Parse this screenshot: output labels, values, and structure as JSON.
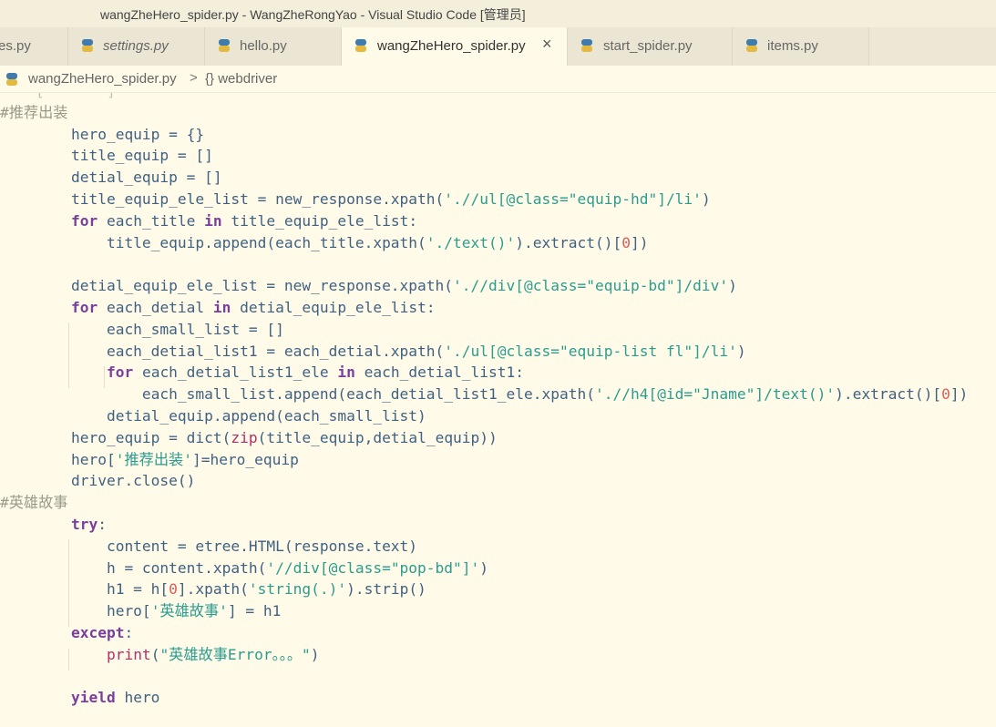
{
  "window": {
    "title": "wangZheHero_spider.py - WangZheRongYao - Visual Studio Code [管理员]"
  },
  "tabs": [
    {
      "label": "es.py",
      "italic": false,
      "active": false
    },
    {
      "label": "settings.py",
      "italic": true,
      "active": false
    },
    {
      "label": "hello.py",
      "italic": false,
      "active": false
    },
    {
      "label": "wangZheHero_spider.py",
      "italic": false,
      "active": true,
      "close": "×"
    },
    {
      "label": "start_spider.py",
      "italic": false,
      "active": false
    },
    {
      "label": "items.py",
      "italic": false,
      "active": false
    }
  ],
  "breadcrumb": {
    "file": "wangZheHero_spider.py",
    "separator": ">",
    "scope_icon": "{}",
    "scope": "webdriver"
  },
  "icons": {
    "python": "python-file-icon",
    "close": "close-icon",
    "chevron": "chevron-right-icon",
    "braces": "braces-icon"
  },
  "colors": {
    "background": "#fffbe8",
    "keyword": "#7a3e9d",
    "string": "#2a9d8f",
    "number": "#e05a5a",
    "comment": "#9a9a8a",
    "identifier": "#3f6183",
    "builtin": "#b0306a"
  },
  "code": {
    "lines": [
      [
        [
          "    [ ‘  ’  ] ‘  ’",
          "faded"
        ]
      ],
      [
        [
          "#推荐出装",
          "cm"
        ]
      ],
      [
        [
          "        hero_equip = {}",
          ""
        ]
      ],
      [
        [
          "        title_equip = []",
          ""
        ]
      ],
      [
        [
          "        detial_equip = []",
          ""
        ]
      ],
      [
        [
          "        title_equip_ele_list = new_response.xpath(",
          ""
        ],
        [
          "'.//ul[@class=\"equip-hd\"]/li'",
          "str"
        ],
        [
          ")",
          ""
        ]
      ],
      [
        [
          "        ",
          ""
        ],
        [
          "for",
          "kw"
        ],
        [
          " each_title ",
          ""
        ],
        [
          "in",
          "kw"
        ],
        [
          " title_equip_ele_list:",
          ""
        ]
      ],
      [
        [
          "            title_equip.append(each_title.xpath(",
          ""
        ],
        [
          "'./text()'",
          "str"
        ],
        [
          ").extract()[",
          ""
        ],
        [
          "0",
          "num"
        ],
        [
          "])",
          ""
        ]
      ],
      [
        [
          "",
          ""
        ]
      ],
      [
        [
          "        detial_equip_ele_list = new_response.xpath(",
          ""
        ],
        [
          "'.//div[@class=\"equip-bd\"]/div'",
          "str"
        ],
        [
          ")",
          ""
        ]
      ],
      [
        [
          "        ",
          ""
        ],
        [
          "for",
          "kw"
        ],
        [
          " each_detial ",
          ""
        ],
        [
          "in",
          "kw"
        ],
        [
          " detial_equip_ele_list:",
          ""
        ]
      ],
      [
        [
          "            each_small_list = []",
          ""
        ]
      ],
      [
        [
          "            each_detial_list1 = each_detial.xpath(",
          ""
        ],
        [
          "'./ul[@class=\"equip-list fl\"]/li'",
          "str"
        ],
        [
          ")",
          ""
        ]
      ],
      [
        [
          "            ",
          ""
        ],
        [
          "for",
          "kw"
        ],
        [
          " each_detial_list1_ele ",
          ""
        ],
        [
          "in",
          "kw"
        ],
        [
          " each_detial_list1:",
          ""
        ]
      ],
      [
        [
          "                each_small_list.append(each_detial_list1_ele.xpath(",
          ""
        ],
        [
          "'.//h4[@id=\"Jname\"]/text()'",
          "str"
        ],
        [
          ").extract()[",
          ""
        ],
        [
          "0",
          "num"
        ],
        [
          "])",
          ""
        ]
      ],
      [
        [
          "            detial_equip.append(each_small_list)",
          ""
        ]
      ],
      [
        [
          "        hero_equip = ",
          ""
        ],
        [
          "dict",
          "fn"
        ],
        [
          "(",
          ""
        ],
        [
          "zip",
          "bi"
        ],
        [
          "(title_equip,detial_equip))",
          ""
        ]
      ],
      [
        [
          "        hero[",
          ""
        ],
        [
          "'推荐出装'",
          "str"
        ],
        [
          "]=hero_equip",
          ""
        ]
      ],
      [
        [
          "        driver.close()",
          ""
        ]
      ],
      [
        [
          "#英雄故事",
          "cm"
        ]
      ],
      [
        [
          "        ",
          ""
        ],
        [
          "try",
          "kw"
        ],
        [
          ":",
          ""
        ]
      ],
      [
        [
          "            content = etree.HTML(response.text)",
          ""
        ]
      ],
      [
        [
          "            h = content.xpath(",
          ""
        ],
        [
          "'//div[@class=\"pop-bd\"]'",
          "str"
        ],
        [
          ")",
          ""
        ]
      ],
      [
        [
          "            h1 = h[",
          ""
        ],
        [
          "0",
          "num"
        ],
        [
          "].xpath(",
          ""
        ],
        [
          "'string(.)'",
          "str"
        ],
        [
          ").strip()",
          ""
        ]
      ],
      [
        [
          "            hero[",
          ""
        ],
        [
          "'英雄故事'",
          "str"
        ],
        [
          "] = h1",
          ""
        ]
      ],
      [
        [
          "        ",
          ""
        ],
        [
          "except",
          "kw"
        ],
        [
          ":",
          ""
        ]
      ],
      [
        [
          "            ",
          ""
        ],
        [
          "print",
          "bi"
        ],
        [
          "(",
          ""
        ],
        [
          "\"英雄故事Error。。。\"",
          "str"
        ],
        [
          ")",
          ""
        ]
      ],
      [
        [
          "",
          ""
        ]
      ],
      [
        [
          "        ",
          ""
        ],
        [
          "yield",
          "kw"
        ],
        [
          " hero",
          ""
        ]
      ]
    ]
  }
}
